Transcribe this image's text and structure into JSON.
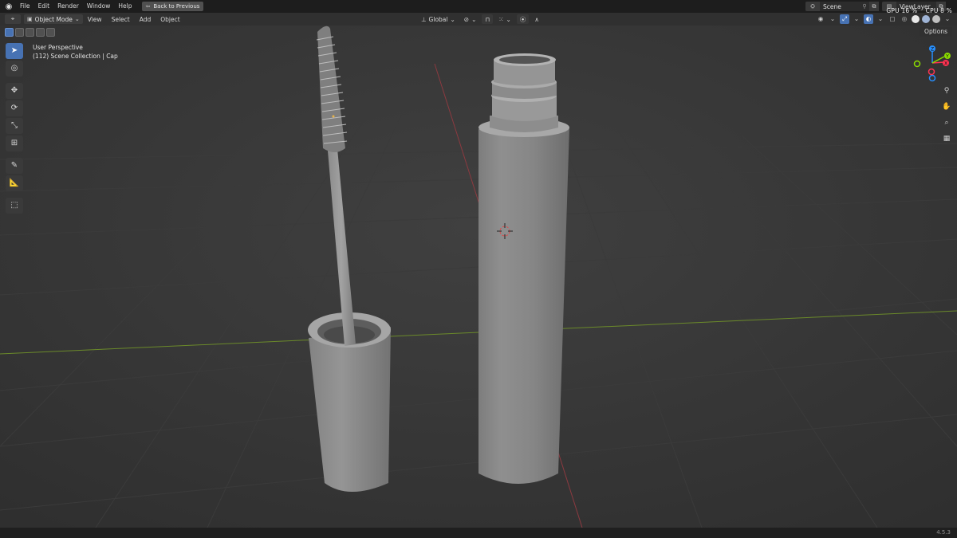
{
  "topbar": {
    "menus": [
      "File",
      "Edit",
      "Render",
      "Window",
      "Help"
    ],
    "back_label": "Back to Previous",
    "scene_name": "Scene",
    "viewlayer_name": "ViewLayer",
    "gpu_label": "GPU",
    "gpu_value": "16 %",
    "cpu_label": "CPU",
    "cpu_value": "8 %"
  },
  "header": {
    "mode": "Object Mode",
    "menus": [
      "View",
      "Select",
      "Add",
      "Object"
    ],
    "transform_orientation": "Global"
  },
  "options_label": "Options",
  "viewport": {
    "perspective": "User Perspective",
    "collection": "(112) Scene Collection | Cap"
  },
  "tools": [
    "select-box",
    "cursor",
    "move",
    "rotate",
    "scale",
    "transform",
    "annotate",
    "measure",
    "add-cube"
  ],
  "gizmo_axes": {
    "x": "X",
    "y": "Y",
    "z": "Z"
  },
  "colors": {
    "accent": "#4772b3",
    "x_axis": "#ff3352",
    "y_axis": "#8bdc00",
    "z_axis": "#2890ff"
  },
  "version": "4.5.3"
}
